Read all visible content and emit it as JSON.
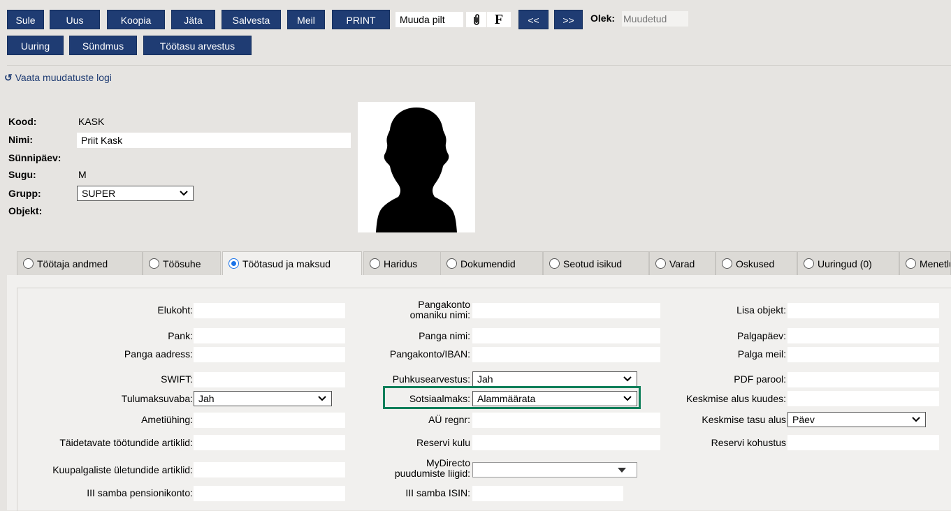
{
  "toolbar": {
    "buttons": [
      "Sule",
      "Uus",
      "Koopia",
      "Jäta",
      "Salvesta",
      "Meil",
      "PRINT"
    ],
    "change_picture": "Muuda pilt",
    "f_label": "F",
    "prev": "<<",
    "next": ">>",
    "state_label": "Olek:",
    "state_value": "Muudetud",
    "row2": [
      "Uuring",
      "Sündmus",
      "Töötasu arvestus"
    ]
  },
  "log_link": "Vaata muudatuste logi",
  "employee": {
    "kood_label": "Kood:",
    "kood": "KASK",
    "nimi_label": "Nimi:",
    "nimi": "Priit Kask",
    "sunnipaev_label": "Sünnipäev:",
    "sugu_label": "Sugu:",
    "sugu": "M",
    "grupp_label": "Grupp:",
    "grupp": "SUPER",
    "objekt_label": "Objekt:"
  },
  "tabs": [
    "Töötaja andmed",
    "Töösuhe",
    "Töötasud ja maksud",
    "Haridus",
    "Dokumendid",
    "Seotud isikud",
    "Varad",
    "Oskused",
    "Uuringud (0)",
    "Menetlused"
  ],
  "active_tab": "Töötasud ja maksud",
  "fields": {
    "col1": {
      "elukoht": "Elukoht:",
      "pank": "Pank:",
      "panga_aadress": "Panga aadress:",
      "swift": "SWIFT:",
      "tulumaksuvaba": "Tulumaksuvaba:",
      "tulumaksuvaba_value": "Jah",
      "ametiuhing": "Ametiühing:",
      "taidetavate": "Täidetavate töötundide artiklid:",
      "kuupalgaliste": "Kuupalgaliste ületundide artiklid:",
      "iii_samba_konto": "III samba pensionikonto:"
    },
    "col2": {
      "pangakonto_omaniku_1": "Pangakonto",
      "pangakonto_omaniku_2": "omaniku nimi:",
      "panga_nimi": "Panga nimi:",
      "pangakonto_iban": "Pangakonto/IBAN:",
      "puhkusearvestus": "Puhkusearvestus:",
      "puhkusearvestus_value": "Jah",
      "sotsiaalmaks": "Sotsiaalmaks:",
      "sotsiaalmaks_value": "Alammäärata",
      "au_regnr": "AÜ regnr:",
      "reservi_kulu": "Reservi kulu",
      "mydirecto_1": "MyDirecto",
      "mydirecto_2": "puudumiste liigid:",
      "iii_samba_isin": "III samba ISIN:"
    },
    "col3": {
      "lisa_objekt": "Lisa objekt:",
      "palgapaev": "Palgapäev:",
      "palga_meil": "Palga meil:",
      "pdf_parool": "PDF parool:",
      "keskmise_alus_kuudes": "Keskmise alus kuudes:",
      "keskmise_tasu_alus": "Keskmise tasu alus",
      "keskmise_tasu_alus_value": "Päev",
      "reservi_kohustus": "Reservi kohustus"
    }
  },
  "colors": {
    "button_bg": "#1f3c73",
    "highlight": "#0f7f5a",
    "radio_active": "#1a73e8"
  }
}
